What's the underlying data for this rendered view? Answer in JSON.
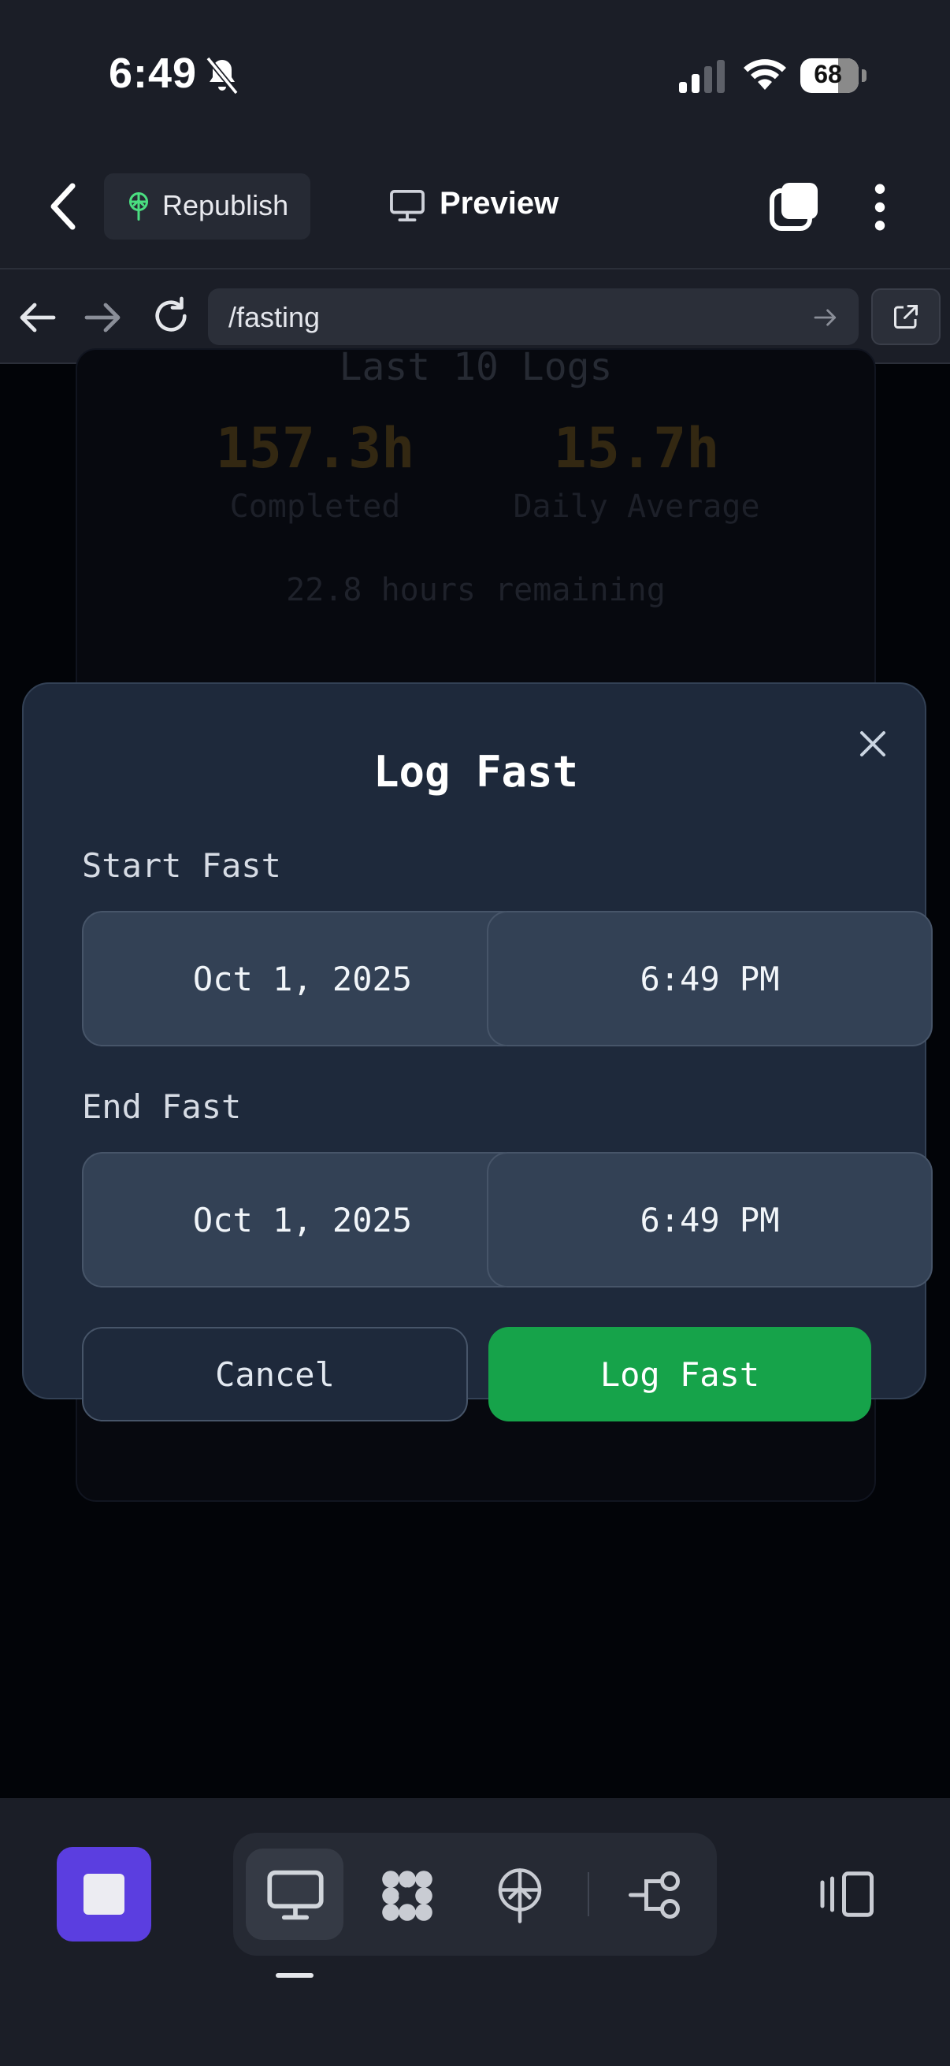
{
  "status_bar": {
    "time": "6:49",
    "battery": "68",
    "icons": [
      "bell-slash-icon",
      "signal-icon",
      "wifi-icon",
      "battery-icon"
    ]
  },
  "top_bar": {
    "republish_label": "Republish",
    "preview_label": "Preview",
    "icons": [
      "back-chevron-icon",
      "republish-icon",
      "monitor-icon",
      "tabs-icon",
      "more-vertical-icon"
    ]
  },
  "url_bar": {
    "path": "/fasting",
    "icons": [
      "arrow-left-icon",
      "arrow-right-icon",
      "reload-icon",
      "go-arrow-icon",
      "external-link-icon"
    ]
  },
  "background": {
    "title": "Last 10 Logs",
    "completed_value": "157.3h",
    "completed_label": "Completed",
    "average_value": "15.7h",
    "average_label": "Daily Average",
    "remaining": "22.8 hours remaining"
  },
  "modal": {
    "title": "Log Fast",
    "start_label": "Start Fast",
    "start_date": "Oct 1, 2025",
    "start_time": "6:49 PM",
    "end_label": "End Fast",
    "end_date": "Oct 1, 2025",
    "end_time": "6:49 PM",
    "cancel_label": "Cancel",
    "submit_label": "Log Fast"
  },
  "bottom_toolbar": {
    "icons": [
      "stop-icon",
      "desktop-icon",
      "workspace-grid-icon",
      "deploy-icon",
      "flow-icon",
      "panel-icon"
    ]
  },
  "colors": {
    "modal_bg": "#1e293b",
    "input_bg": "#334155",
    "primary_green": "#16a34a",
    "stop_purple": "#5b3ee0",
    "stat_amber_dim": "#332812"
  }
}
